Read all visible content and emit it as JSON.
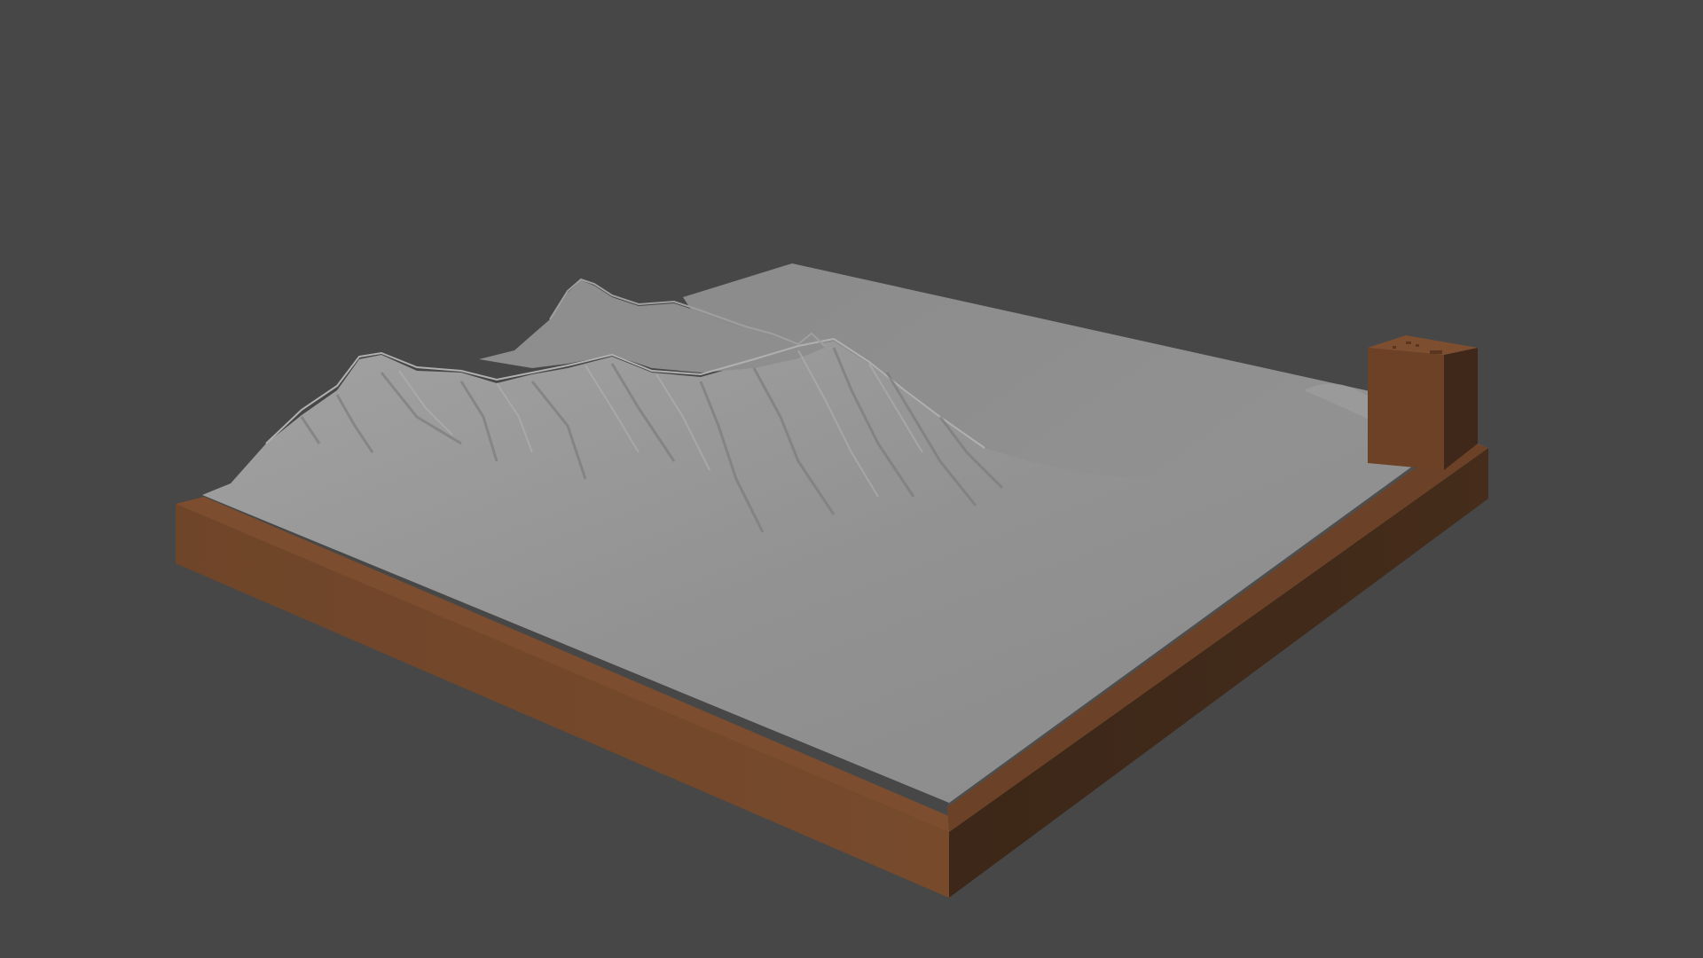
{
  "viewport": {
    "background_color": "#474747"
  },
  "model": {
    "terrain_color": "#8f8f8f",
    "terrain_highlight_color": "#a6a6a6",
    "terrain_shadow_color": "#6e6e6e",
    "base_front_color": "#71462b",
    "base_side_color": "#3b2618",
    "base_top_color": "#7a4c2e",
    "tab_color": "#6e4226"
  }
}
